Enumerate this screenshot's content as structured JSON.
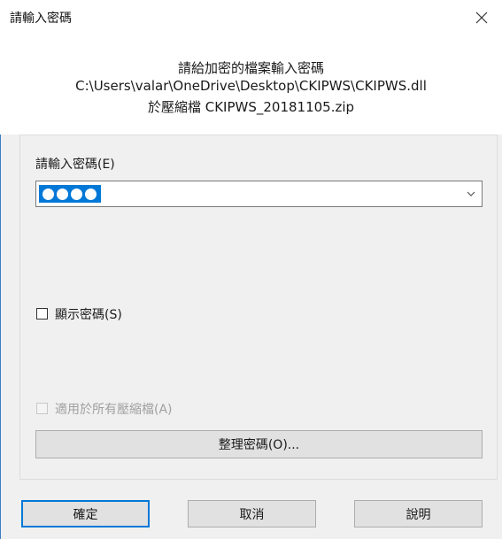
{
  "window": {
    "title": "請輸入密碼"
  },
  "header": {
    "prompt": "請給加密的檔案輸入密碼",
    "file_path": "C:\\Users\\valar\\OneDrive\\Desktop\\CKIPWS\\CKIPWS.dll",
    "archive_line": "於壓縮檔 CKIPWS_20181105.zip"
  },
  "password": {
    "label": "請輸入密碼(E)",
    "masked_length": 4
  },
  "options": {
    "show_password": {
      "label": "顯示密碼(S)",
      "checked": false,
      "enabled": true
    },
    "apply_to_all": {
      "label": "適用於所有壓縮檔(A)",
      "checked": false,
      "enabled": false
    }
  },
  "organize_button": "整理密碼(O)...",
  "buttons": {
    "ok": "確定",
    "cancel": "取消",
    "help": "說明"
  },
  "colors": {
    "accent": "#0078d7",
    "selection": "#0078d7"
  },
  "icons": {
    "close": "close-icon",
    "dropdown": "chevron-down-icon"
  }
}
